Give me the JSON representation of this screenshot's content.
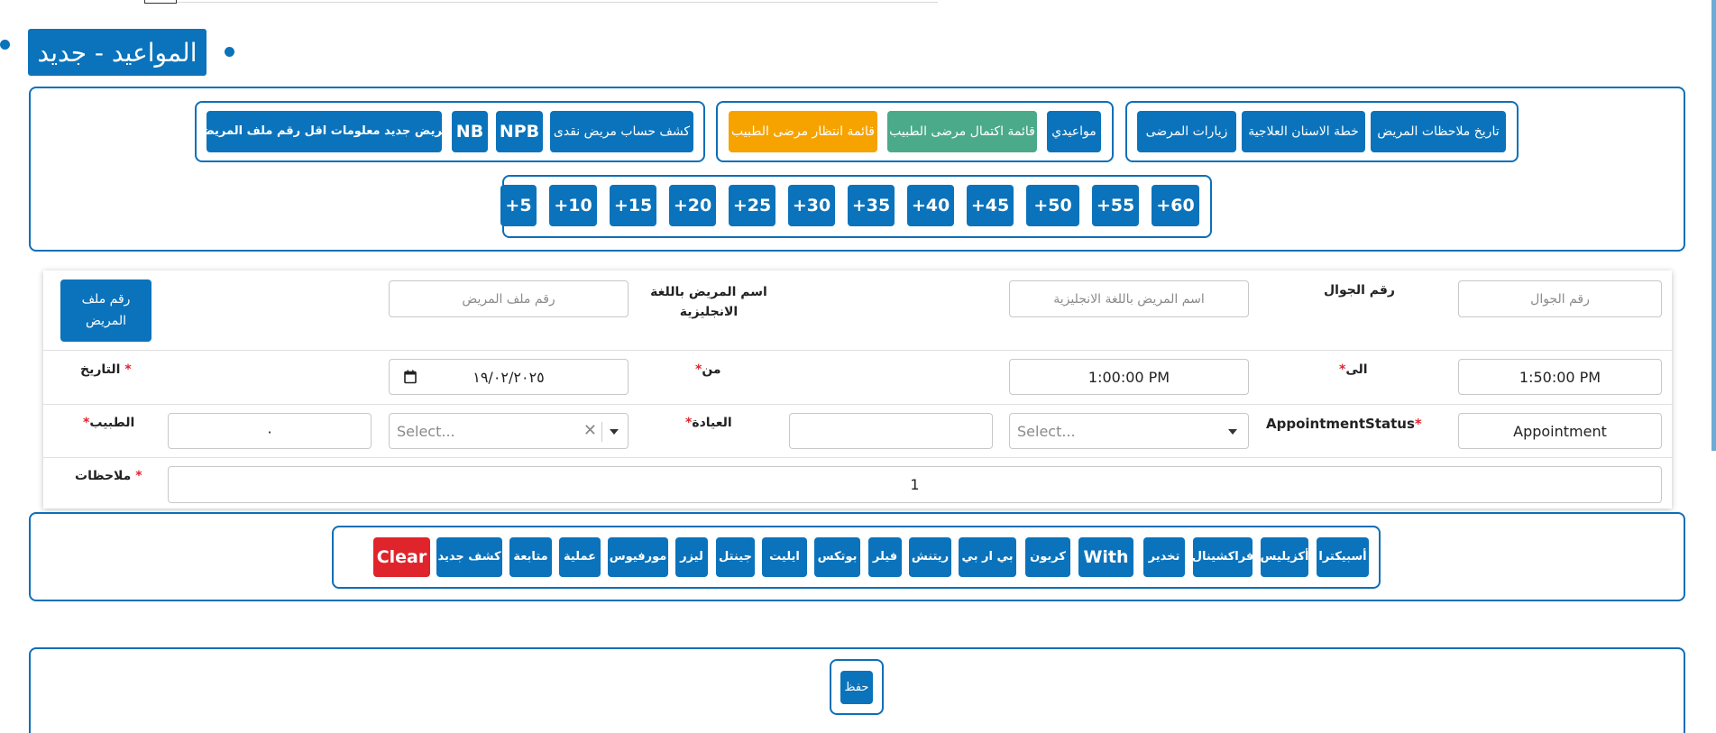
{
  "page_title": "المواعيد - جديد",
  "nav_row1": {
    "group_a": [
      "تاريخ ملاحظات المريض",
      "خطة الاسنان العلاجية",
      "زيارات المرضى"
    ],
    "group_b": [
      "مواعيدي",
      "قائمة اكتمال مرضى الطبيب",
      "قائمة انتظار مرضى الطبيب"
    ],
    "group_c": [
      "كشف حساب مريض نقدى",
      "NPB",
      "NB",
      "مريض جديد معلومات اقل رقم ملف المريض"
    ]
  },
  "time_buttons": [
    "+60",
    "+55",
    "+50",
    "+45",
    "+40",
    "+35",
    "+30",
    "+25",
    "+20",
    "+15",
    "+10",
    "+5"
  ],
  "form": {
    "mobile_label": "رقم الجوال",
    "mobile_placeholder": "رقم الجوال",
    "name_en_label": "اسم المريض باللغة الانجليزية",
    "name_en_placeholder": "اسم المريض باللغة الانجليزية",
    "file_no_placeholder": "رقم ملف المريض",
    "file_no_button": "رقم ملف المريض",
    "to_label": "الى",
    "to_value": "1:50:00 PM",
    "from_label": "من",
    "from_value": "1:00:00 PM",
    "date_label": "التاريخ",
    "date_value": "١٩/٠٢/٢٠٢٥",
    "status_label": "AppointmentStatus",
    "status_value": "Appointment",
    "clinic_label": "العيادة",
    "select_placeholder": "Select...",
    "doctor_label": "الطبيب",
    "doctor_value": "٠",
    "notes_label": "ملاحظات",
    "notes_value": "1",
    "required_mark": "*"
  },
  "procedure_buttons": [
    "أسبيكترا",
    "أكزيليس",
    "فراكشينال",
    "تخدير",
    "With",
    "كربون",
    "بي ار بي",
    "ريتنش",
    "فيلر",
    "بوتكس",
    "ايليت",
    "جينتل",
    "ليزر",
    "مورفيوس",
    "عملية",
    "متابعة",
    "كشف جديد",
    "Clear"
  ],
  "save_label": "حفظ"
}
